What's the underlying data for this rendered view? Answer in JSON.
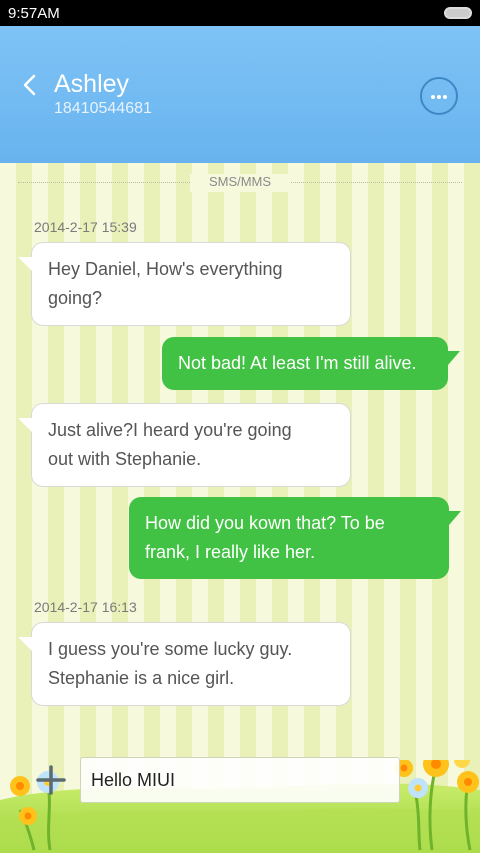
{
  "status_bar": {
    "time": "9:57AM"
  },
  "header": {
    "contact_name": "Ashley",
    "contact_number": "18410544681"
  },
  "channel_label": "SMS/MMS",
  "timestamps": [
    "2014-2-17 15:39",
    "2014-2-17 16:13"
  ],
  "messages": [
    {
      "direction": "in",
      "lines": [
        "Hey Daniel, How's everything",
        "going?"
      ]
    },
    {
      "direction": "out",
      "lines": [
        "Not bad! At least I'm still alive."
      ]
    },
    {
      "direction": "in",
      "lines": [
        "Just  alive?I heard you're going",
        "out with Stephanie."
      ]
    },
    {
      "direction": "out",
      "lines": [
        "How did you kown that? To be",
        "frank, I really like her."
      ]
    },
    {
      "direction": "in",
      "lines": [
        "I guess you're some lucky guy.",
        "Stephanie is a nice girl."
      ]
    }
  ],
  "composer": {
    "text": "Hello MIUI"
  },
  "colors": {
    "header": "#6db6f1",
    "outgoing": "#41c244",
    "incoming": "#ffffff",
    "stripe_light": "#f6f9dc",
    "stripe_dark": "#e9f0b8"
  }
}
